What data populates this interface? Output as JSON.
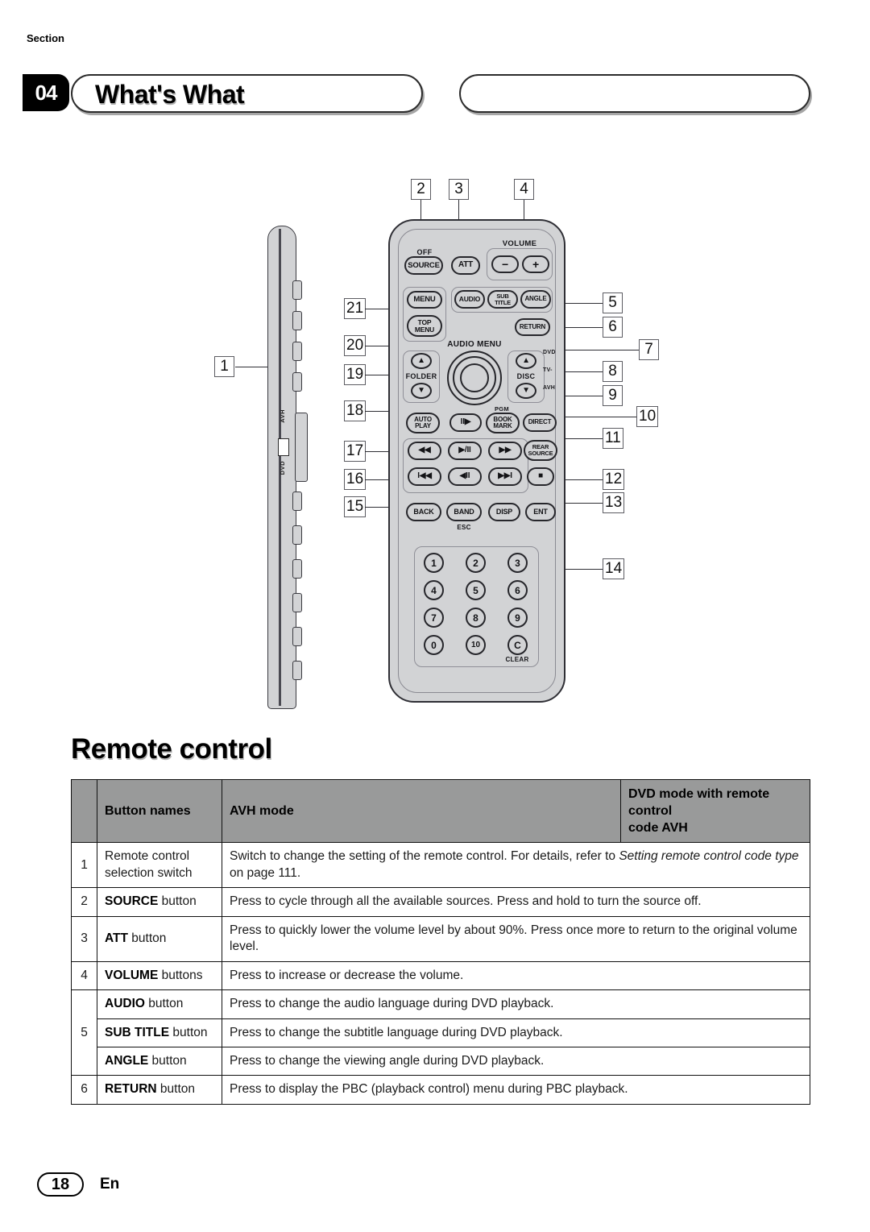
{
  "header": {
    "section_label": "Section",
    "section_number": "04",
    "title": "What's What"
  },
  "figure": {
    "caption_numbers_left": [
      "21",
      "20",
      "19",
      "18",
      "17",
      "16",
      "15"
    ],
    "caption_numbers_top": [
      "2",
      "3",
      "4"
    ],
    "caption_numbers_right": [
      "5",
      "6",
      "7",
      "8",
      "9",
      "10",
      "11",
      "12",
      "13",
      "14"
    ],
    "caption_number_sideview": "1",
    "side_view": {
      "switch_label_top": "AVH",
      "switch_label_bottom": "DVD"
    },
    "front_view": {
      "off_label": "OFF",
      "source_button": "SOURCE",
      "att_button": "ATT",
      "volume_label": "VOLUME",
      "volume_minus": "−",
      "volume_plus": "+",
      "menu_button": "MENU",
      "top_menu_button": "TOP\nMENU",
      "top_menu_line1": "TOP",
      "top_menu_line2": "MENU",
      "audio_button": "AUDIO",
      "sub_title_line1": "SUB",
      "sub_title_line2": "TITLE",
      "angle_button": "ANGLE",
      "return_button": "RETURN",
      "audio_menu_label": "AUDIO MENU",
      "folder_label": "FOLDER",
      "disc_label": "DISC",
      "selector_dvd": "DVD",
      "selector_tv": "TV-",
      "selector_avh": "AVH",
      "auto_play_line1": "AUTO",
      "auto_play_line2": "PLAY",
      "slow_button": "II▶",
      "pgm_label": "PGM",
      "book_mark_line1": "BOOK",
      "book_mark_line2": "MARK",
      "direct_button": "DIRECT",
      "rev_button": "◀◀",
      "play_pause_button": "▶/II",
      "fwd_button": "▶▶",
      "rear_source_line1": "REAR",
      "rear_source_line2": "SOURCE",
      "prev_button": "I◀◀",
      "frame_rev_button": "◀II",
      "next_button": "▶▶I",
      "stop_button": "■",
      "back_button": "BACK",
      "band_button": "BAND",
      "esc_label": "ESC",
      "disp_button": "DISP",
      "ent_button": "ENT",
      "keypad": [
        "1",
        "2",
        "3",
        "4",
        "5",
        "6",
        "7",
        "8",
        "9",
        "0",
        "10",
        "C"
      ],
      "clear_label": "CLEAR"
    }
  },
  "remote_section": {
    "heading": "Remote control"
  },
  "table": {
    "headers": {
      "num": "",
      "button_names": "Button names",
      "avh_mode": "AVH mode",
      "dvd_mode_line1": "DVD mode with remote control",
      "dvd_mode_line2": "code AVH"
    },
    "rows": [
      {
        "num": "1",
        "name": "Remote control selection switch",
        "name_plain": true,
        "desc_pre": "Switch to change the setting of the remote control. For details, refer to ",
        "desc_italic": "Setting remote control code type",
        "desc_post": " on page 111.",
        "span": true
      },
      {
        "num": "2",
        "name_bold": "SOURCE",
        "name_rest": " button",
        "desc": "Press to cycle through all the available sources. Press and hold to turn the source off.",
        "span": true
      },
      {
        "num": "3",
        "name_bold": "ATT",
        "name_rest": " button",
        "desc": "Press to quickly lower the volume level by about 90%. Press once more to return to the original volume level.",
        "span": true
      },
      {
        "num": "4",
        "name_bold": "VOLUME",
        "name_rest": " buttons",
        "desc": "Press to increase or decrease the volume.",
        "span": true
      },
      {
        "num": "5",
        "name_bold": "AUDIO",
        "name_rest": " button",
        "desc": "Press to change the audio language during DVD playback.",
        "span": true,
        "group_start": true
      },
      {
        "num": "",
        "name_bold": "SUB TITLE",
        "name_rest": " button",
        "desc": "Press to change the subtitle language during DVD playback.",
        "span": true
      },
      {
        "num": "",
        "name_bold": "ANGLE",
        "name_rest": " button",
        "desc": "Press to change the viewing angle during DVD playback.",
        "span": true
      },
      {
        "num": "6",
        "name_bold": "RETURN",
        "name_rest": " button",
        "desc": "Press to display the PBC (playback control) menu during PBC playback.",
        "span": true
      }
    ]
  },
  "footer": {
    "page_number": "18",
    "language": "En"
  }
}
